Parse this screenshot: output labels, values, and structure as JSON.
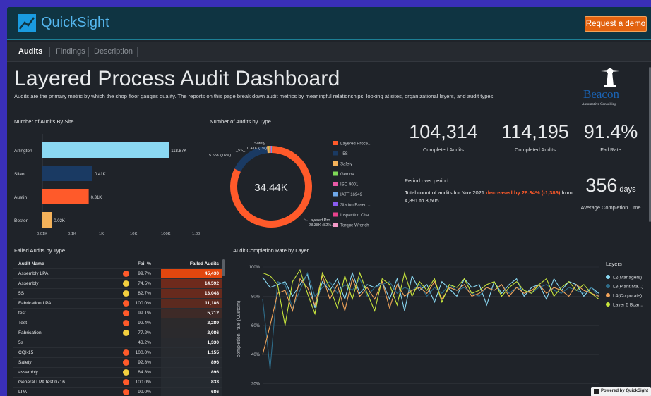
{
  "header": {
    "logo_text": "QuickSight",
    "demo_button": "Request a demo"
  },
  "tabs": [
    "Audits",
    "Findings",
    "Description"
  ],
  "dashboard": {
    "title": "Layered Process Audit Dashboard",
    "subtitle": "Audits are the primary metric by which the shop floor gauges quality. The reports on this page break down audit metrics by meaningful relationships, looking at sites, organizational layers, and audit types."
  },
  "brand": {
    "name": "Beacon",
    "tagline": "Automotive Consulting"
  },
  "sites_chart": {
    "title": "Number of Audits By Site",
    "bars": [
      {
        "label": "Arlington",
        "value_label": "118.87K",
        "value": 118870,
        "color": "#8ad8f2"
      },
      {
        "label": "Silao",
        "value_label": "0.41K",
        "value": 410,
        "color": "#1a3a63"
      },
      {
        "label": "Austin",
        "value_label": "0.31K",
        "value": 310,
        "color": "#ff5a2a"
      },
      {
        "label": "Boston",
        "value_label": "0.02K",
        "value": 20,
        "color": "#f4b25a"
      }
    ],
    "ticks": [
      "0.01K",
      "0.1K",
      "1K",
      "10K",
      "100K",
      "1,000K"
    ],
    "scale": "log"
  },
  "type_chart": {
    "title": "Number of Audits by Type",
    "center": "34.44K",
    "slices": [
      {
        "name": "Layered Process",
        "pct": 82,
        "color": "#ff5a2a"
      },
      {
        "name": "_5S_",
        "pct": 16,
        "color": "#1a3a63"
      },
      {
        "name": "Safety",
        "pct": 1,
        "color": "#f4b25a"
      },
      {
        "name": "Gemba",
        "pct": 0.4,
        "color": "#7ed957"
      },
      {
        "name": "ISO 9001",
        "pct": 0.3,
        "color": "#e85aa6"
      },
      {
        "name": "IATF 16949",
        "pct": 0.3,
        "color": "#6fa8e8"
      }
    ],
    "callouts": {
      "safety": "Safety",
      "safety_val": "0.41K (1%)",
      "s5": "_5S_",
      "s5_val": "5.55K (16%)",
      "lp": "Layered Pro...",
      "lp_val": "28.38K (82%..."
    },
    "legend": [
      {
        "label": "Layered Proce...",
        "color": "#ff5a2a"
      },
      {
        "label": "_5S_",
        "color": "#1a3a63"
      },
      {
        "label": "Safety",
        "color": "#f4b25a"
      },
      {
        "label": "Gemba",
        "color": "#7ed957"
      },
      {
        "label": "ISO 9001",
        "color": "#e85aa6"
      },
      {
        "label": "IATF 16949",
        "color": "#6fa8e8"
      },
      {
        "label": "Station Based ...",
        "color": "#8a5cf0"
      },
      {
        "label": "Inspection Cha...",
        "color": "#e8428c"
      },
      {
        "label": "Torque Wrench",
        "color": "#f49ac8"
      }
    ]
  },
  "kpis": {
    "completed1": {
      "value": "104,314",
      "label": "Completed Audits"
    },
    "completed2": {
      "value": "114,195",
      "label": "Completed Audits"
    },
    "fail_rate": {
      "value": "91.4%",
      "label": "Fail Rate"
    },
    "avg_days": {
      "value": "356",
      "unit": "days",
      "label": "Average Completion Time"
    }
  },
  "period": {
    "title": "Period over period",
    "text_before": "Total count of audits for Nov 2021 ",
    "highlight": "decreased by 28.34% (-1,386)",
    "text_after": " from 4,891 to 3,505."
  },
  "failed_table": {
    "title": "Failed Audits by Type",
    "headers": [
      "Audit Name",
      "Fail %",
      "Failed Audits"
    ],
    "rows": [
      {
        "name": "Assembly LPA",
        "dot": "#ff5a2a",
        "fail": "99.7%",
        "count": "45,430",
        "bg": "#e2470f"
      },
      {
        "name": "Assembly",
        "dot": "#f4d03f",
        "fail": "74.5%",
        "count": "14,592",
        "bg": "#6e2a1c"
      },
      {
        "name": "5S",
        "dot": "#f4d03f",
        "fail": "82.7%",
        "count": "13,048",
        "bg": "#672a1d"
      },
      {
        "name": "Fabrication LPA",
        "dot": "#ff5a2a",
        "fail": "100.0%",
        "count": "11,186",
        "bg": "#5c2a1f"
      },
      {
        "name": "test",
        "dot": "#ff5a2a",
        "fail": "99.1%",
        "count": "5,712",
        "bg": "#3e2a27"
      },
      {
        "name": "Test",
        "dot": "#ff5a2a",
        "fail": "92.4%",
        "count": "2,289",
        "bg": "#2c2a2c"
      },
      {
        "name": "Fabrication",
        "dot": "#f4d03f",
        "fail": "77.2%",
        "count": "2,086",
        "bg": "#2b2a2d"
      },
      {
        "name": "5s",
        "dot": "",
        "fail": "43.2%",
        "count": "1,330",
        "bg": "#282a2f"
      },
      {
        "name": "CQI-15",
        "dot": "#ff5a2a",
        "fail": "100.0%",
        "count": "1,155",
        "bg": "#272a2f"
      },
      {
        "name": "Safety",
        "dot": "#ff5a2a",
        "fail": "92.8%",
        "count": "896",
        "bg": "#262a30"
      },
      {
        "name": "assembly",
        "dot": "#f4d03f",
        "fail": "84.8%",
        "count": "896",
        "bg": "#262a30"
      },
      {
        "name": "General LPA test 0716",
        "dot": "#ff5a2a",
        "fail": "100.0%",
        "count": "833",
        "bg": "#252a30"
      },
      {
        "name": "LPA",
        "dot": "#ff5a2a",
        "fail": "99.0%",
        "count": "686",
        "bg": "#252a30"
      }
    ]
  },
  "chart_data": {
    "type": "line",
    "title": "Audit Completion Rate by Layer",
    "xlabel": "",
    "ylabel": "completion_rate (Custom)",
    "ylim": [
      15,
      100
    ],
    "yticks": [
      "100%",
      "80%",
      "60%",
      "40%",
      "20%"
    ],
    "legend_title": "Layers",
    "series": [
      {
        "name": "L2(Managers)",
        "color": "#8ad8f2",
        "values": [
          93,
          86,
          88,
          90,
          80,
          88,
          95,
          72,
          90,
          84,
          92,
          78,
          96,
          82,
          88,
          86,
          90,
          78,
          92,
          70,
          94,
          84,
          88,
          76,
          90,
          85,
          80,
          92,
          86,
          88,
          74,
          90,
          82,
          88,
          92,
          80,
          86,
          88,
          78,
          92,
          84,
          90,
          88,
          80,
          86,
          82
        ]
      },
      {
        "name": "L3(Plant Ma...)",
        "color": "#2f6d8a",
        "values": [
          78,
          30,
          90,
          88,
          72,
          84,
          96,
          80,
          86,
          90,
          82,
          88,
          84,
          92,
          80,
          86,
          88,
          90,
          82,
          86,
          84,
          88,
          80,
          86,
          82,
          88,
          84,
          86,
          82,
          80,
          86,
          84,
          88,
          82,
          86,
          84,
          82,
          86,
          88,
          84,
          82,
          86,
          84,
          82,
          86,
          80
        ]
      },
      {
        "name": "L4(Corporate)",
        "color": "#f4a55a",
        "values": [
          40,
          60,
          82,
          84,
          70,
          92,
          86,
          74,
          94,
          78,
          88,
          70,
          92,
          80,
          86,
          78,
          90,
          72,
          88,
          80,
          84,
          86,
          82,
          90,
          78,
          86,
          84,
          88,
          80,
          82,
          86,
          84,
          88,
          80,
          86,
          82,
          84,
          88,
          82,
          86,
          84,
          80,
          88,
          84,
          82,
          80
        ]
      },
      {
        "name": "Layer 5 Boar...",
        "color": "#c8e63c",
        "values": [
          96,
          94,
          88,
          60,
          90,
          98,
          82,
          68,
          96,
          86,
          72,
          94,
          78,
          96,
          82,
          70,
          92,
          88,
          74,
          96,
          80,
          90,
          84,
          92,
          76,
          88,
          86,
          92,
          82,
          84,
          88,
          90,
          80,
          86,
          90,
          84,
          82,
          88,
          92,
          80,
          86,
          90,
          84,
          88,
          82,
          78
        ]
      }
    ]
  },
  "footer": {
    "powered": "Powered by QuickSight"
  }
}
